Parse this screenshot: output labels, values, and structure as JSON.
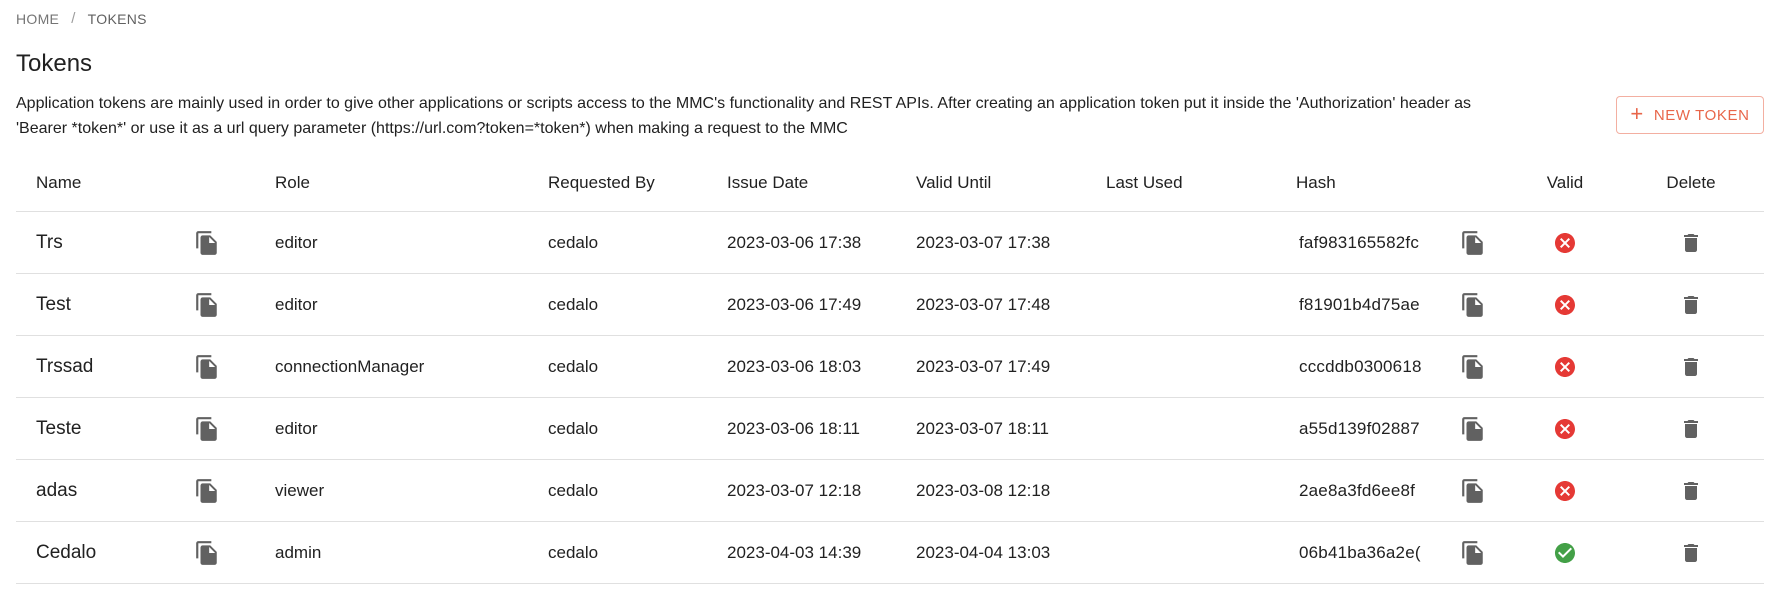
{
  "breadcrumb": {
    "home": "HOME",
    "separator": "/",
    "current": "TOKENS"
  },
  "page": {
    "title": "Tokens",
    "description": "Application tokens are mainly used in order to give other applications or scripts access to the MMC's functionality and REST APIs. After creating an application token put it inside the 'Authorization' header as 'Bearer *token*' or use it as a url query parameter (https://url.com?token=*token*) when making a request to the MMC",
    "new_token_label": "NEW TOKEN",
    "new_token_icon": "plus-icon"
  },
  "colors": {
    "accent": "#e8664a",
    "valid": "#43a047",
    "invalid": "#e53935",
    "icon": "#616161"
  },
  "table": {
    "headers": {
      "name": "Name",
      "role": "Role",
      "requested_by": "Requested By",
      "issue_date": "Issue Date",
      "valid_until": "Valid Until",
      "last_used": "Last Used",
      "hash": "Hash",
      "valid": "Valid",
      "delete": "Delete"
    },
    "rows": [
      {
        "name": "Trs",
        "role": "editor",
        "requested_by": "cedalo",
        "issue_date": "2023-03-06 17:38",
        "valid_until": "2023-03-07 17:38",
        "last_used": "",
        "hash": "faf983165582fc",
        "valid": false
      },
      {
        "name": "Test",
        "role": "editor",
        "requested_by": "cedalo",
        "issue_date": "2023-03-06 17:49",
        "valid_until": "2023-03-07 17:48",
        "last_used": "",
        "hash": "f81901b4d75ae",
        "valid": false
      },
      {
        "name": "Trssad",
        "role": "connectionManager",
        "requested_by": "cedalo",
        "issue_date": "2023-03-06 18:03",
        "valid_until": "2023-03-07 17:49",
        "last_used": "",
        "hash": "cccddb0300618",
        "valid": false
      },
      {
        "name": "Teste",
        "role": "editor",
        "requested_by": "cedalo",
        "issue_date": "2023-03-06 18:11",
        "valid_until": "2023-03-07 18:11",
        "last_used": "",
        "hash": "a55d139f02887",
        "valid": false
      },
      {
        "name": "adas",
        "role": "viewer",
        "requested_by": "cedalo",
        "issue_date": "2023-03-07 12:18",
        "valid_until": "2023-03-08 12:18",
        "last_used": "",
        "hash": "2ae8a3fd6ee8f",
        "valid": false
      },
      {
        "name": "Cedalo",
        "role": "admin",
        "requested_by": "cedalo",
        "issue_date": "2023-04-03 14:39",
        "valid_until": "2023-04-04 13:03",
        "last_used": "",
        "hash": "06b41ba36a2e(",
        "valid": true
      }
    ]
  }
}
